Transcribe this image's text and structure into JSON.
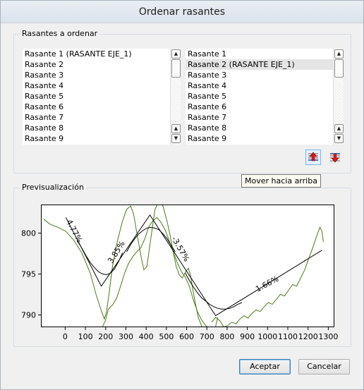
{
  "window": {
    "title": "Ordenar rasantes"
  },
  "order_group": {
    "legend": "Rasantes a ordenar",
    "left_list": [
      "Rasante 1 (RASANTE EJE_1)",
      "Rasante 2",
      "Rasante 3",
      "Rasante 4",
      "Rasante 5",
      "Rasante 6",
      "Rasante 7",
      "Rasante 8",
      "Rasante 9"
    ],
    "right_list": [
      "Rasante 1",
      "Rasante 2 (RASANTE EJE_1)",
      "Rasante 3",
      "Rasante 4",
      "Rasante 5",
      "Rasante 6",
      "Rasante 7",
      "Rasante 8",
      "Rasante 9"
    ],
    "right_selected": "Rasante 2 (RASANTE EJE_1)",
    "move_up_icon": "arrow-up-icon",
    "move_down_icon": "arrow-down-icon",
    "tooltip": "Mover hacia arriba"
  },
  "preview_group": {
    "legend": "Previsualización"
  },
  "chart_data": {
    "type": "line",
    "title": "",
    "xlabel": "",
    "ylabel": "",
    "xlim": [
      -120,
      1330
    ],
    "ylim": [
      788.5,
      803.5
    ],
    "x_ticks": [
      "0",
      "100",
      "200",
      "300",
      "400",
      "500",
      "600",
      "700",
      "800",
      "900",
      "1000",
      "1100",
      "1200",
      "1300"
    ],
    "y_ticks": [
      "800",
      "795",
      "790"
    ],
    "terrain_color": "#4a7a1a",
    "grade_color": "#000000",
    "terrain_segments": [
      {
        "x": [
          -110,
          -80,
          -40,
          0,
          40,
          80,
          120,
          150,
          175,
          190,
          200,
          215,
          230,
          255,
          280,
          300,
          320,
          335,
          350,
          370,
          385,
          400,
          420,
          440,
          460,
          480,
          500,
          515,
          530,
          545,
          560,
          575,
          590,
          605,
          615,
          625,
          640,
          655,
          670,
          690,
          710,
          730,
          750
        ],
        "y": [
          801.8,
          801.2,
          800.8,
          800.3,
          799.2,
          797.6,
          795.2,
          792.5,
          790.6,
          789.6,
          790.4,
          793.0,
          796.0,
          799.2,
          801.6,
          803.0,
          803.4,
          802.4,
          800.2,
          797.4,
          795.6,
          796.0,
          799.5,
          803.0,
          804.0,
          803.4,
          801.5,
          799.8,
          797.8,
          796.0,
          795.0,
          794.6,
          795.3,
          795.8,
          795.0,
          793.5,
          791.5,
          789.7,
          788.8,
          787.5,
          786.5,
          787.6,
          789.8
        ]
      },
      {
        "x": [
          180,
          195,
          210,
          230,
          250,
          270,
          290,
          310,
          330,
          350,
          370,
          390,
          410,
          430,
          450,
          470,
          490,
          510,
          530,
          550,
          570,
          590,
          610,
          630,
          650,
          670,
          690,
          700
        ],
        "y": [
          788.6,
          789.4,
          790.8,
          791.3,
          792.1,
          793.6,
          795.2,
          796.4,
          797.2,
          797.8,
          798.3,
          799.4,
          800.9,
          801.6,
          802.0,
          801.4,
          800.5,
          799.2,
          797.8,
          796.5,
          795.4,
          794.7,
          793.6,
          791.9,
          790.5,
          789.5,
          788.8,
          788.6
        ]
      },
      {
        "x": [
          720,
          740,
          760,
          780,
          800,
          820,
          840,
          860,
          880,
          900,
          920,
          940,
          960,
          980,
          1000,
          1020,
          1040,
          1060,
          1080,
          1100,
          1120,
          1140,
          1160,
          1180,
          1200,
          1220,
          1240,
          1255,
          1265,
          1272
        ],
        "y": [
          789.2,
          789.8,
          789.4,
          788.6,
          788.8,
          789.2,
          789.0,
          789.6,
          790.0,
          789.7,
          790.3,
          790.7,
          790.5,
          791.1,
          791.6,
          791.4,
          792.0,
          792.6,
          792.4,
          793.1,
          793.8,
          793.6,
          794.6,
          795.6,
          797.0,
          798.3,
          799.8,
          800.8,
          800.3,
          799.0
        ]
      }
    ],
    "grade_polyline": {
      "x": [
        0,
        175,
        415,
        740,
        1265
      ],
      "y": [
        802.0,
        793.6,
        802.3,
        790.0,
        798.0
      ]
    },
    "vertical_curves": [
      {
        "x": [
          60,
          80,
          100,
          120,
          140,
          160,
          180,
          200,
          220,
          240,
          260,
          280
        ],
        "y": [
          799.0,
          798.2,
          797.3,
          796.5,
          795.9,
          795.4,
          795.1,
          795.0,
          795.2,
          795.7,
          796.6,
          797.7
        ]
      },
      {
        "x": [
          300,
          320,
          340,
          360,
          380,
          400,
          420,
          440,
          460,
          480,
          500,
          520,
          540
        ],
        "y": [
          797.8,
          798.7,
          799.4,
          800.0,
          800.4,
          800.7,
          800.8,
          800.7,
          800.5,
          800.0,
          799.4,
          798.6,
          797.8
        ]
      },
      {
        "x": [
          590,
          610,
          630,
          650,
          670,
          690,
          710,
          730,
          750,
          770,
          790,
          810,
          830,
          850,
          870
        ],
        "y": [
          795.2,
          794.3,
          793.5,
          792.8,
          792.2,
          791.8,
          791.4,
          791.1,
          790.9,
          790.8,
          790.8,
          790.9,
          791.1,
          791.4,
          791.6
        ]
      }
    ],
    "annotations": [
      {
        "text": "4.77%",
        "x": 30,
        "y": 800.2,
        "angle": 62
      },
      {
        "text": "3.85%",
        "x": 260,
        "y": 797.6,
        "angle": -58
      },
      {
        "text": "-3.57%",
        "x": 555,
        "y": 798.0,
        "angle": 60
      },
      {
        "text": "1.66%",
        "x": 1000,
        "y": 793.6,
        "angle": -28
      }
    ]
  },
  "buttons": {
    "accept": "Aceptar",
    "cancel": "Cancelar"
  }
}
